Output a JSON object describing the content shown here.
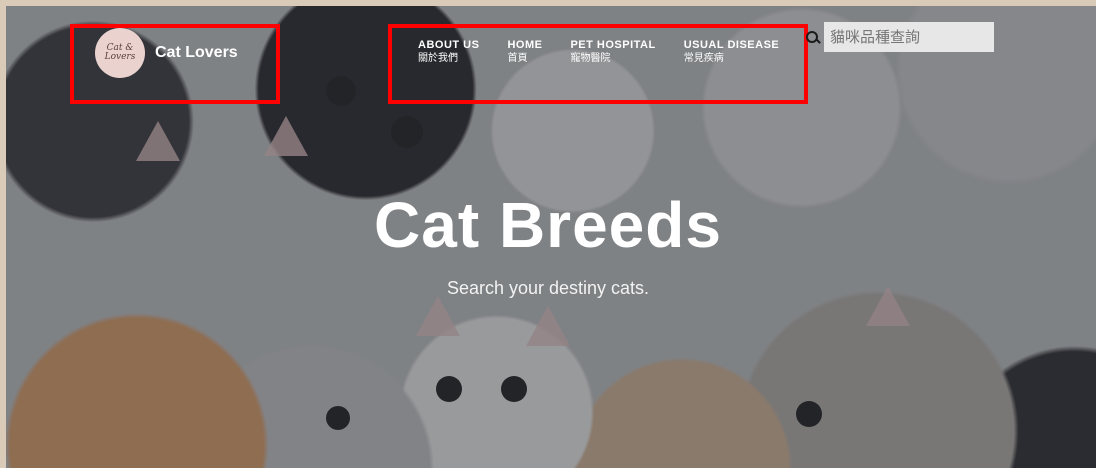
{
  "brand": {
    "logo_text": "Cat & Lovers",
    "name": "Cat Lovers"
  },
  "nav": {
    "items": [
      {
        "en": "ABOUT US",
        "zh": "關於我們"
      },
      {
        "en": "HOME",
        "zh": "首頁"
      },
      {
        "en": "PET HOSPITAL",
        "zh": "寵物醫院"
      },
      {
        "en": "USUAL DISEASE",
        "zh": "常見疾病"
      }
    ]
  },
  "search": {
    "placeholder": "貓咪品種查詢",
    "icon": "search-icon"
  },
  "hero": {
    "title": "Cat Breeds",
    "subtitle": "Search your destiny cats."
  },
  "colors": {
    "highlight": "#ff0000",
    "logo_bg": "#ead3cf",
    "text": "#ffffff"
  }
}
